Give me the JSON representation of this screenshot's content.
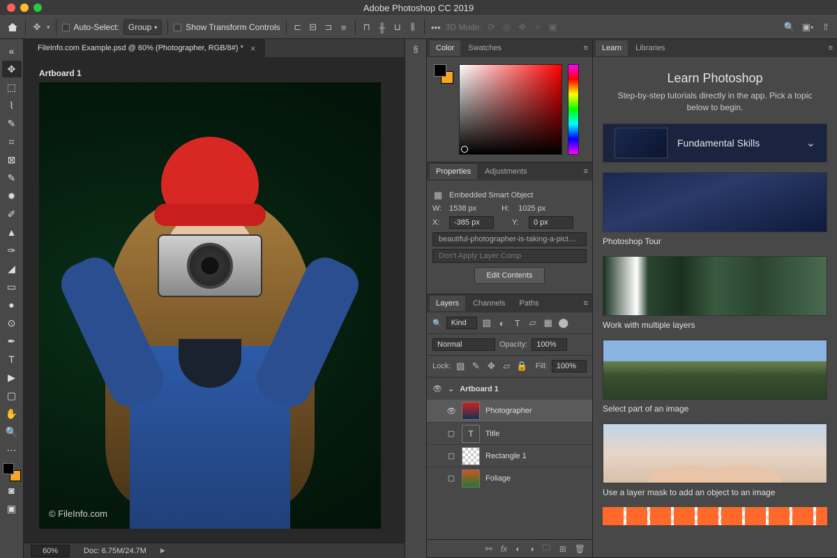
{
  "titlebar": {
    "title": "Adobe Photoshop CC 2019"
  },
  "options": {
    "auto_select_label": "Auto-Select:",
    "auto_select_mode": "Group",
    "show_transform": "Show Transform Controls",
    "mode3d_label": "3D Mode:"
  },
  "document": {
    "tab_title": "FileInfo.com Example.psd @ 60% (Photographer, RGB/8#) *",
    "artboard_label": "Artboard 1",
    "watermark": "© FileInfo.com",
    "zoom": "60%",
    "doc_size": "Doc: 6.75M/24.7M"
  },
  "tabs": {
    "color": "Color",
    "swatches": "Swatches",
    "properties": "Properties",
    "adjustments": "Adjustments",
    "layers": "Layers",
    "channels": "Channels",
    "paths": "Paths",
    "learn": "Learn",
    "libraries": "Libraries"
  },
  "properties": {
    "type": "Embedded Smart Object",
    "w_label": "W:",
    "w": "1538 px",
    "h_label": "H:",
    "h": "1025 px",
    "x_label": "X:",
    "x": "-385 px",
    "y_label": "Y:",
    "y": "0 px",
    "filename": "beautiful-photographer-is-taking-a-pict…",
    "layer_comp": "Don't Apply Layer Comp",
    "edit_contents": "Edit Contents"
  },
  "layers": {
    "filter_label": "Kind",
    "blend_mode": "Normal",
    "opacity_label": "Opacity:",
    "opacity": "100%",
    "lock_label": "Lock:",
    "fill_label": "Fill:",
    "fill": "100%",
    "items": [
      {
        "name": "Artboard 1",
        "is_group": true,
        "visible": true
      },
      {
        "name": "Photographer",
        "visible": true,
        "selected": true
      },
      {
        "name": "Title",
        "type": "T",
        "visible": false
      },
      {
        "name": "Rectangle 1",
        "visible": false
      },
      {
        "name": "Foliage",
        "visible": false
      }
    ]
  },
  "learn": {
    "title": "Learn Photoshop",
    "subtitle": "Step-by-step tutorials directly in the app. Pick a topic below to begin.",
    "section": "Fundamental Skills",
    "lessons": [
      "Photoshop Tour",
      "Work with multiple layers",
      "Select part of an image",
      "Use a layer mask to add an object to an image"
    ]
  }
}
